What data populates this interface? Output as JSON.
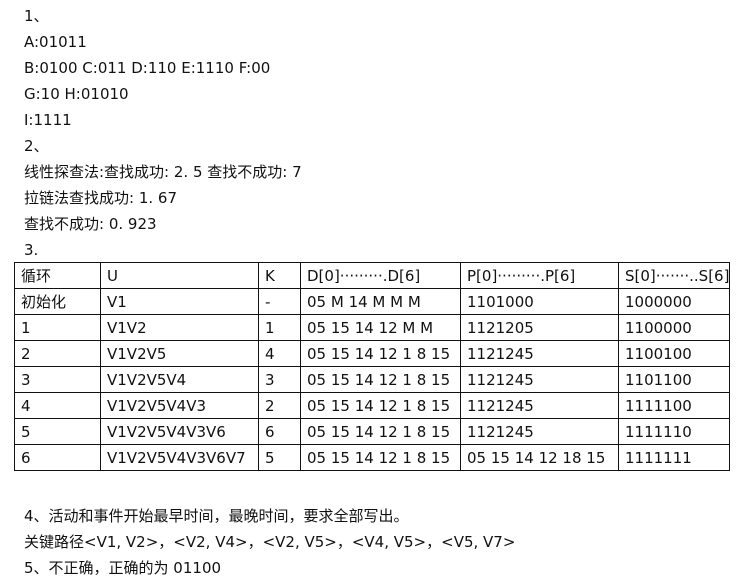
{
  "q1": {
    "number": "1、",
    "lines": [
      "A:01011",
      "B:0100 C:011 D:110 E:1110 F:00",
      "G:10 H:01010",
      "I:1111"
    ]
  },
  "q2": {
    "number": "2、",
    "lines": [
      "线性探查法:查找成功: 2. 5 查找不成功: 7",
      "拉链法查找成功: 1. 67",
      "查找不成功: 0. 923"
    ]
  },
  "q3": {
    "number": "3.",
    "table": {
      "headers": [
        "循环",
        "U",
        "K",
        "D[0]·········.D[6]",
        "P[0]·········.P[6]",
        "S[0]·······..S[6]"
      ],
      "rows": [
        [
          "初始化",
          "V1",
          "-",
          "05 M 14 M M M",
          "1101000",
          "1000000"
        ],
        [
          "1",
          "V1V2",
          "1",
          "05 15 14 12 M M",
          "1121205",
          "1100000"
        ],
        [
          "2",
          "V1V2V5",
          "4",
          "05 15 14 12 1 8 15",
          "1121245",
          "1100100"
        ],
        [
          "3",
          "V1V2V5V4",
          "3",
          "05 15 14 12 1 8 15",
          "1121245",
          "1101100"
        ],
        [
          "4",
          "V1V2V5V4V3",
          "2",
          "05 15 14 12 1 8 15",
          "1121245",
          "1111100"
        ],
        [
          "5",
          "V1V2V5V4V3V6",
          "6",
          "05 15 14 12 1 8 15",
          "1121245",
          "1111110"
        ],
        [
          "6",
          "V1V2V5V4V3V6V7",
          "5",
          "05 15 14 12 1 8 15",
          "05 15 14 12 18 15",
          "1111111"
        ]
      ]
    }
  },
  "q4": {
    "text": "4、活动和事件开始最早时间，最晚时间，要求全部写出。",
    "critical_path": "关键路径<V1, V2>，<V2, V4>，<V2, V5>，<V4, V5>，<V5, V7>"
  },
  "q5": {
    "text": "5、不正确，正确的为 01100"
  }
}
